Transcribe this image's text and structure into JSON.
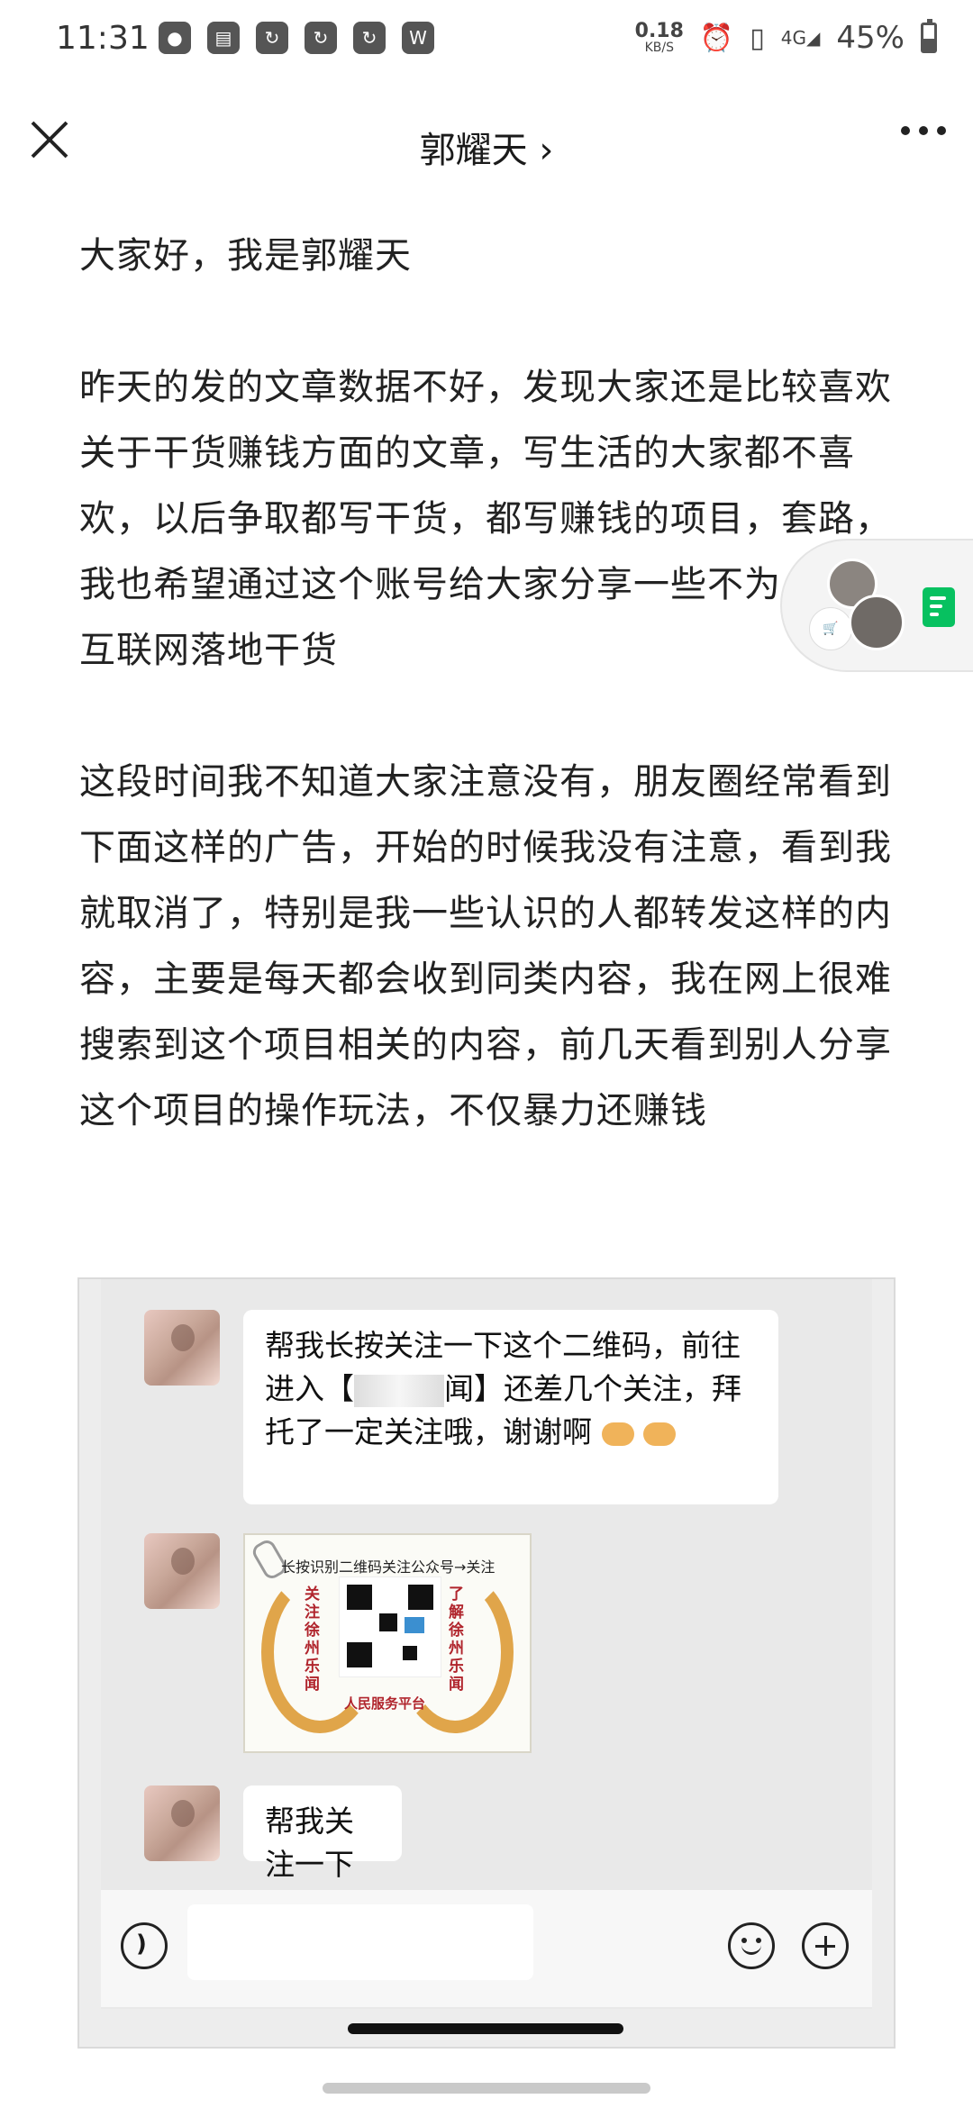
{
  "status_bar": {
    "time": "11:31",
    "apps": [
      "weibo-icon",
      "doc-icon",
      "refresh-icon",
      "refresh-icon",
      "refresh-icon",
      "wps-icon"
    ],
    "net_speed_value": "0.18",
    "net_speed_unit": "KB/S",
    "network": "4G",
    "battery": "45%",
    "battery_level": 0.45
  },
  "nav": {
    "title": "郭耀天 ›"
  },
  "article": {
    "paragraphs": [
      "大家好，我是郭耀天",
      "昨天的发的文章数据不好，发现大家还是比较喜欢关于干货赚钱方面的文章，写生活的大家都不喜欢，以后争取都写干货，都写赚钱的项目，套路，我也希望通过这个账号给大家分享一些不为人知的互联网落地干货",
      "这段时间我不知道大家注意没有，朋友圈经常看到下面这样的广告，开始的时候我没有注意，看到我就取消了，特别是我一些认识的人都转发这样的内容，主要是每天都会收到同类内容，我在网上很难搜索到这个项目相关的内容，前几天看到别人分享这个项目的操作玩法，不仅暴力还赚钱"
    ]
  },
  "chat": {
    "message1_a": "帮我长按关注一下这个二维码，前往进入【",
    "message1_b": "闻】还差几个关注，拜托了一定关注哦，谢谢啊",
    "qr_title": "长按识别二维码关注公众号→关注",
    "qr_left": "关注徐州乐闻",
    "qr_right": "了解徐州乐闻",
    "qr_bottom": "人民服务平台",
    "message2": "帮我关注一下"
  }
}
